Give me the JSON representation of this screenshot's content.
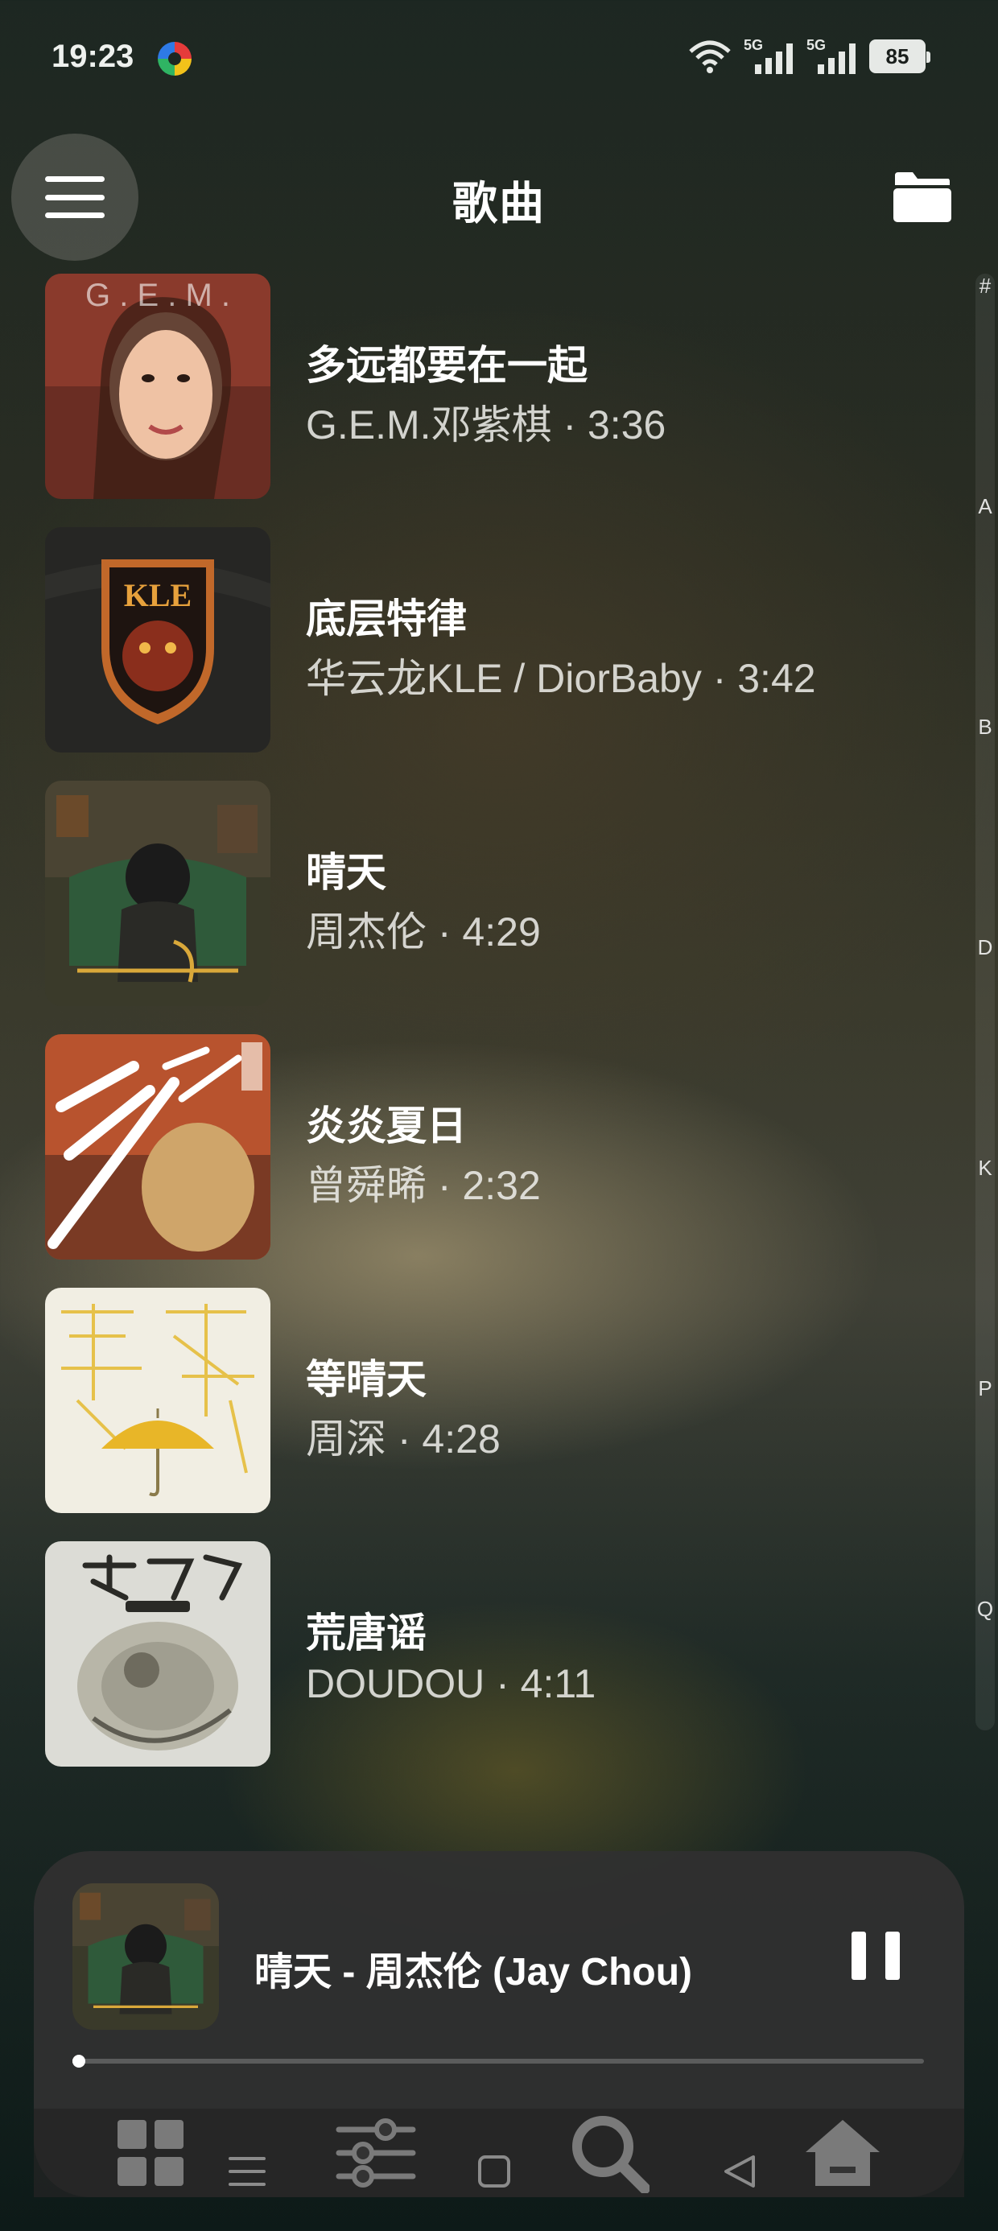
{
  "status_bar": {
    "time": "19:23",
    "network_labels": [
      "5G",
      "5G"
    ],
    "battery": "85"
  },
  "header": {
    "title": "歌曲",
    "menu_icon": "hamburger-menu-icon",
    "folder_icon": "folder-icon"
  },
  "alphabet_index": [
    "#",
    "A",
    "B",
    "D",
    "K",
    "P",
    "Q"
  ],
  "songs": [
    {
      "title": "多远都要在一起",
      "meta": "G.E.M.邓紫棋 · 3:36"
    },
    {
      "title": "底层特律",
      "meta": "华云龙KLE / DiorBaby · 3:42"
    },
    {
      "title": "晴天",
      "meta": "周杰伦 · 4:29"
    },
    {
      "title": "炎炎夏日",
      "meta": "曾舜晞 · 2:32"
    },
    {
      "title": "等晴天",
      "meta": "周深 · 4:28"
    },
    {
      "title": "荒唐谣",
      "meta": "DOUDOU · 4:11"
    }
  ],
  "album_text": {
    "gem": "G . E . M .",
    "kle": "KLE"
  },
  "now_playing": {
    "title": "晴天 - 周杰伦 (Jay Chou)",
    "progress": 0.004
  },
  "nav_icons": [
    "grid-icon",
    "equalizer-icon",
    "search-icon",
    "home-icon"
  ],
  "system_nav_icons": [
    "recent-apps-icon",
    "home-square-icon",
    "back-icon"
  ],
  "colors": {
    "accent": "#ffffff",
    "player_bg": "#303030"
  }
}
